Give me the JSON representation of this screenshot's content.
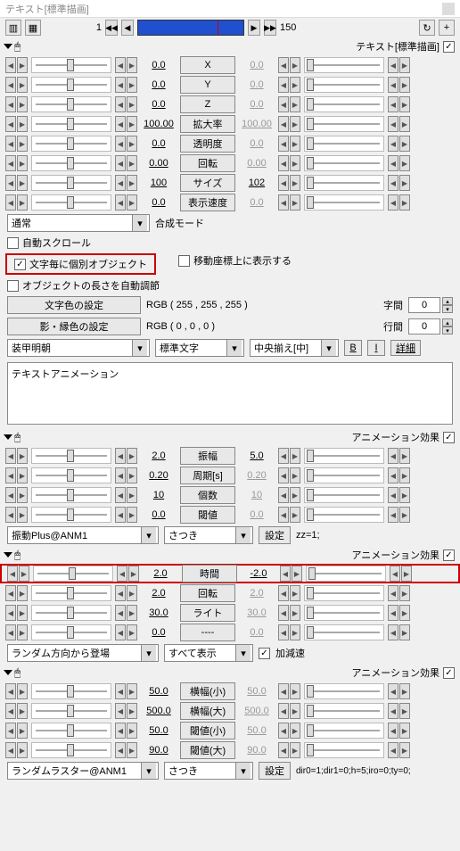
{
  "title": "テキスト[標準描画]",
  "scrub": {
    "frame_start": "1",
    "frame_end": "150"
  },
  "section1": {
    "title": "テキスト[標準描画]",
    "params": [
      {
        "v1": "0.0",
        "btn": "X",
        "v2": "0.0"
      },
      {
        "v1": "0.0",
        "btn": "Y",
        "v2": "0.0"
      },
      {
        "v1": "0.0",
        "btn": "Z",
        "v2": "0.0"
      },
      {
        "v1": "100.00",
        "btn": "拡大率",
        "v2": "100.00"
      },
      {
        "v1": "0.0",
        "btn": "透明度",
        "v2": "0.0"
      },
      {
        "v1": "0.00",
        "btn": "回転",
        "v2": "0.00"
      },
      {
        "v1": "100",
        "btn": "サイズ",
        "v2": "102"
      },
      {
        "v1": "0.0",
        "btn": "表示速度",
        "v2": "0.0"
      }
    ],
    "blend_mode": "通常",
    "blend_label": "合成モード",
    "autoscroll": "自動スクロール",
    "perchar": "文字毎に個別オブジェクト",
    "showcoord": "移動座標上に表示する",
    "autolen": "オブジェクトの長さを自動調節",
    "colorbtn": "文字色の設定",
    "colorval": "RGB ( 255 , 255 , 255 )",
    "shadowbtn": "影・縁色の設定",
    "shadowval": "RGB ( 0 , 0 , 0 )",
    "spacing_label": "字間",
    "spacing": "0",
    "lineh_label": "行間",
    "lineh": "0",
    "font": "装甲明朝",
    "chartype": "標準文字",
    "align": "中央揃え[中]",
    "b": "B",
    "i": "I",
    "detail": "詳細",
    "textbox": "テキストアニメーション"
  },
  "anim1": {
    "title": "アニメーション効果",
    "params": [
      {
        "v1": "2.0",
        "btn": "振幅",
        "v2": "5.0"
      },
      {
        "v1": "0.20",
        "btn": "周期[s]",
        "v2": "0.20"
      },
      {
        "v1": "10",
        "btn": "個数",
        "v2": "10"
      },
      {
        "v1": "0.0",
        "btn": "閾値",
        "v2": "0.0"
      }
    ],
    "script": "振動Plus@ANM1",
    "author": "さつき",
    "setbtn": "設定",
    "expr": "zz=1;"
  },
  "anim2": {
    "title": "アニメーション効果",
    "params": [
      {
        "v1": "2.0",
        "btn": "時間",
        "v2": "-2.0"
      },
      {
        "v1": "2.0",
        "btn": "回転",
        "v2": "2.0"
      },
      {
        "v1": "30.0",
        "btn": "ライト",
        "v2": "30.0"
      },
      {
        "v1": "0.0",
        "btn": "----",
        "v2": "0.0"
      }
    ],
    "script": "ランダム方向から登場",
    "show": "すべて表示",
    "decel": "加減速"
  },
  "anim3": {
    "title": "アニメーション効果",
    "params": [
      {
        "v1": "50.0",
        "btn": "横幅(小)",
        "v2": "50.0"
      },
      {
        "v1": "500.0",
        "btn": "横幅(大)",
        "v2": "500.0"
      },
      {
        "v1": "50.0",
        "btn": "閾値(小)",
        "v2": "50.0"
      },
      {
        "v1": "90.0",
        "btn": "閾値(大)",
        "v2": "90.0"
      }
    ],
    "script": "ランダムラスター@ANM1",
    "author": "さつき",
    "setbtn": "設定",
    "expr": "dir0=1;dir1=0;h=5;iro=0;ty=0;"
  }
}
